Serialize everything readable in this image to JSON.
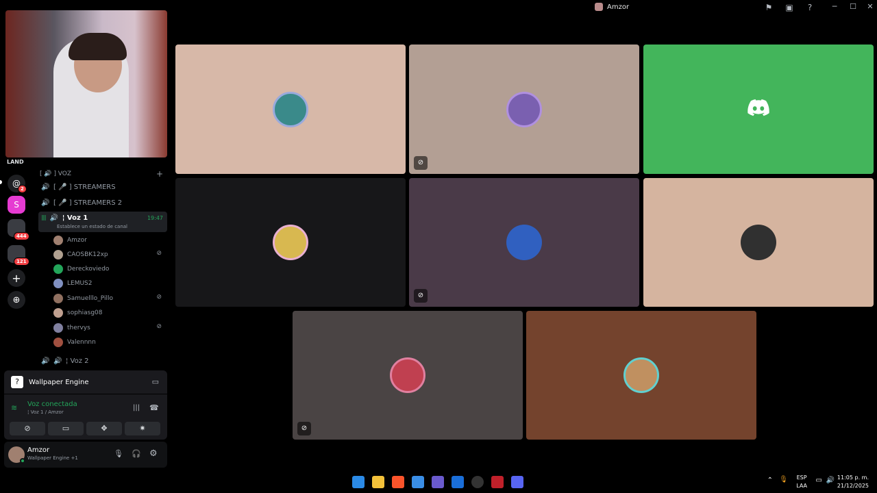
{
  "window": {
    "title": "Amzor"
  },
  "taskbar": {
    "language_line1": "ESP",
    "language_line2": "LAA",
    "time": "11:05 p. m.",
    "date": "21/12/2025"
  },
  "rail": {
    "server_label": "LAND",
    "badges": [
      "2",
      "444",
      "121"
    ]
  },
  "channels": {
    "category": "[ 🔊 ] VOZ",
    "items": [
      {
        "label": "[ 🎤 ] STREAMERS"
      },
      {
        "label": "[ 🎤 ] STREAMERS 2"
      },
      {
        "label": "¦ Voz 1",
        "time": "19:47",
        "status": "Establece un estado de canal"
      },
      {
        "label": "¦ Voz 2"
      }
    ],
    "members": [
      {
        "name": "Amzor",
        "muted": false,
        "color": "#a08070"
      },
      {
        "name": "CAOSBK12xp",
        "muted": true,
        "color": "#b0a090"
      },
      {
        "name": "Dereckoviedo",
        "muted": false,
        "color": "#23a55a"
      },
      {
        "name": "LEMUS2",
        "muted": false,
        "color": "#8090c0"
      },
      {
        "name": "Samuelllo_Pillo",
        "muted": true,
        "color": "#907060"
      },
      {
        "name": "sophiasg08",
        "muted": false,
        "color": "#c0a090"
      },
      {
        "name": "thervys",
        "muted": true,
        "color": "#8080a0"
      },
      {
        "name": "Valennnn",
        "muted": false,
        "color": "#a05040"
      }
    ]
  },
  "activity": {
    "title": "Wallpaper Engine"
  },
  "voice": {
    "status": "Voz conectada",
    "channel": "¦ Voz 1 / Amzor"
  },
  "user": {
    "name": "Amzor",
    "activity": "Wallpaper Engine +1"
  },
  "tiles": [
    {
      "bg": "#d7b8a8",
      "avatar": "#3a8a8a",
      "muted": false
    },
    {
      "bg": "#b39f94",
      "avatar": "#7a60b0",
      "muted": true
    },
    {
      "bg": "#43b55b",
      "avatar": "discord-logo",
      "muted": false
    },
    {
      "bg": "#171719",
      "avatar": "#d8b850",
      "muted": false
    },
    {
      "bg": "#4a3a48",
      "avatar": "#3060c0",
      "muted": true
    },
    {
      "bg": "#d5b49f",
      "avatar": "#303030",
      "muted": false
    },
    {
      "bg": "#4a4444",
      "avatar": "#c04050",
      "muted": true
    },
    {
      "bg": "#74432d",
      "avatar": "#c09060",
      "muted": false
    }
  ],
  "colors": {
    "connected_green": "#23a55a",
    "badge_red": "#f23f43"
  }
}
